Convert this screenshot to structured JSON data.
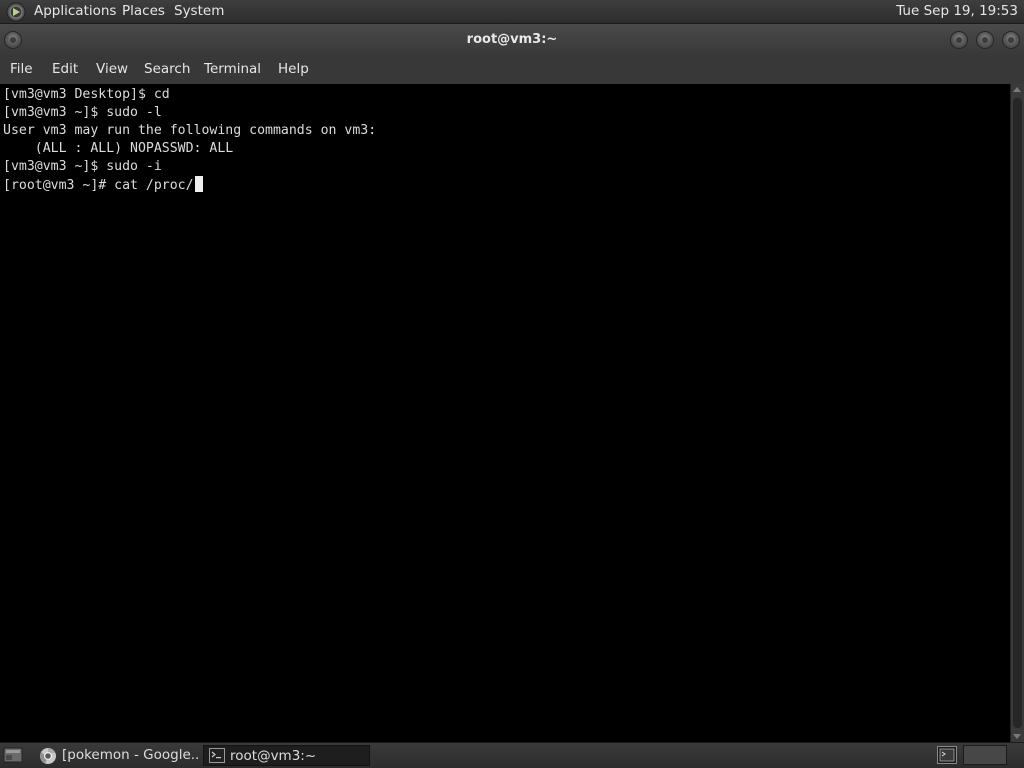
{
  "top_panel": {
    "menus": [
      "Applications",
      "Places",
      "System"
    ],
    "clock": "Tue Sep 19, 19:53"
  },
  "window": {
    "title": "root@vm3:~"
  },
  "menubar": [
    "File",
    "Edit",
    "View",
    "Search",
    "Terminal",
    "Help"
  ],
  "terminal": {
    "lines": [
      "[vm3@vm3 Desktop]$ cd",
      "[vm3@vm3 ~]$ sudo -l",
      "User vm3 may run the following commands on vm3:",
      "    (ALL : ALL) NOPASSWD: ALL",
      "[vm3@vm3 ~]$ sudo -i",
      "[root@vm3 ~]# cat /proc/"
    ]
  },
  "taskbar": {
    "items": [
      {
        "label": "[pokemon - Google...",
        "icon": "chrome-icon",
        "active": false
      },
      {
        "label": "root@vm3:~",
        "icon": "terminal-icon",
        "active": true
      }
    ]
  },
  "colors": {
    "terminal_bg": "#000000",
    "terminal_fg": "#dcdcdc",
    "panel_bg": "#2d2d2d"
  }
}
